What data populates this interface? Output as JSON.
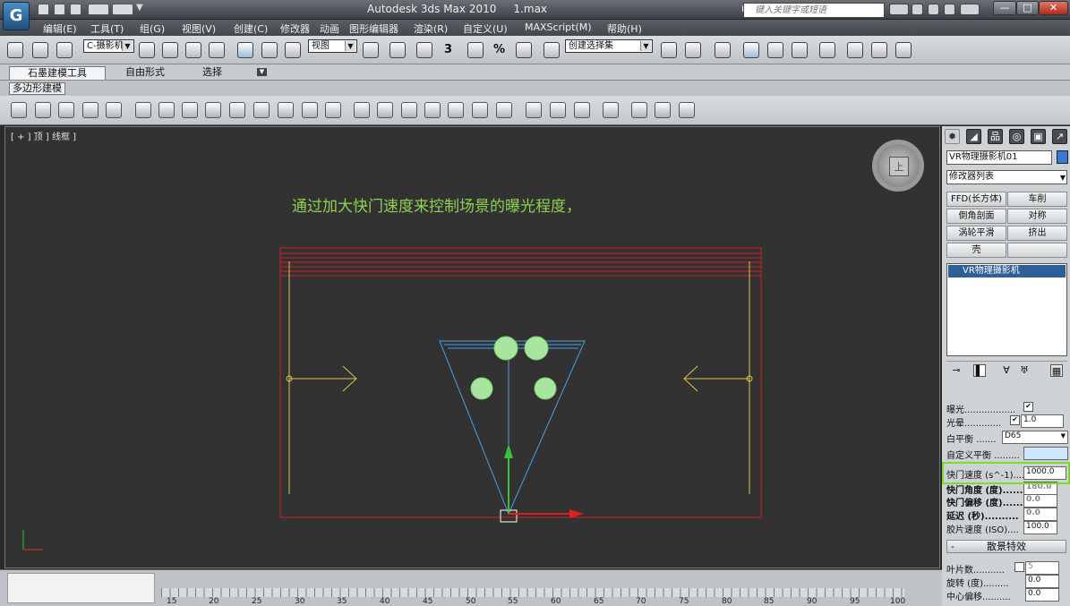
{
  "window": {
    "title": "Autodesk 3ds Max  2010",
    "file": "1.max",
    "search_placeholder": "键入关键字或短语",
    "logo": "3ds-max-logo"
  },
  "menu": [
    "编辑(E)",
    "工具(T)",
    "组(G)",
    "视图(V)",
    "创建(C)",
    "修改器",
    "动画",
    "图形编辑器",
    "渲染(R)",
    "自定义(U)",
    "MAXScript(M)",
    "帮助(H)"
  ],
  "toolbar": {
    "filter_selector": "C-摄影机",
    "ref_coord": "视图",
    "named_selection": "创建选择集",
    "snap_labels": [
      "3",
      "%"
    ]
  },
  "ribbon": {
    "tabs": [
      "石墨建模工具",
      "自由形式",
      "选择"
    ],
    "active_tab": 0,
    "sub_label": "多边形建模"
  },
  "viewport": {
    "label": "[ + ] 顶 ] 线框 ]",
    "overlay_text": "通过加大快门速度来控制场景的曝光程度，",
    "viewcube_face": "上"
  },
  "command_panel": {
    "object_name": "VR物理摄影机01",
    "object_color": "#3a78d6",
    "modifier_list": "修改器列表",
    "modifier_buttons": [
      [
        "FFD(长方体)",
        "车削"
      ],
      [
        "倒角剖面",
        "对称"
      ],
      [
        "涡轮平滑",
        "挤出"
      ],
      [
        "壳",
        ""
      ]
    ],
    "stack_item": "VR物理摄影机",
    "params": [
      {
        "label": "曝光..................",
        "checked": true
      },
      {
        "label": "光晕.............",
        "checked": true,
        "value": "1.0"
      },
      {
        "label": "白平衡 .......",
        "value": "D65",
        "dropdown": true
      },
      {
        "label": "自定义平衡 .........",
        "swatch": "#cfe6ff"
      },
      {
        "label": "快门速度 (s^-1)....",
        "value": "1000.0",
        "highlight": true
      },
      {
        "label": "快门角度 (度)......",
        "value": "180.0"
      },
      {
        "label": "快门偏移 (度)......",
        "value": "0.0"
      },
      {
        "label": "延迟 (秒)..........",
        "value": "0.0"
      },
      {
        "label": "胶片速度 (ISO)....",
        "value": "100.0"
      }
    ],
    "rollout_title": "散景特效",
    "bokeh_params": [
      {
        "label": "叶片数...........",
        "checked": false,
        "value": "5"
      },
      {
        "label": "旋转 (度).........",
        "value": "0.0"
      },
      {
        "label": "中心偏移..........",
        "value": "0.0"
      }
    ]
  },
  "timeline": {
    "ticks": [
      "15",
      "20",
      "25",
      "30",
      "35",
      "40",
      "45",
      "50",
      "55",
      "60",
      "65",
      "70",
      "75",
      "80",
      "85",
      "90",
      "95",
      "100"
    ]
  },
  "colors": {
    "overlay_text": "#8fd14f",
    "highlight": "#7ddc2a",
    "scene_red": "#c8202a",
    "camera_blue": "#4aa0e0",
    "light_green": "#a8e6a0"
  }
}
